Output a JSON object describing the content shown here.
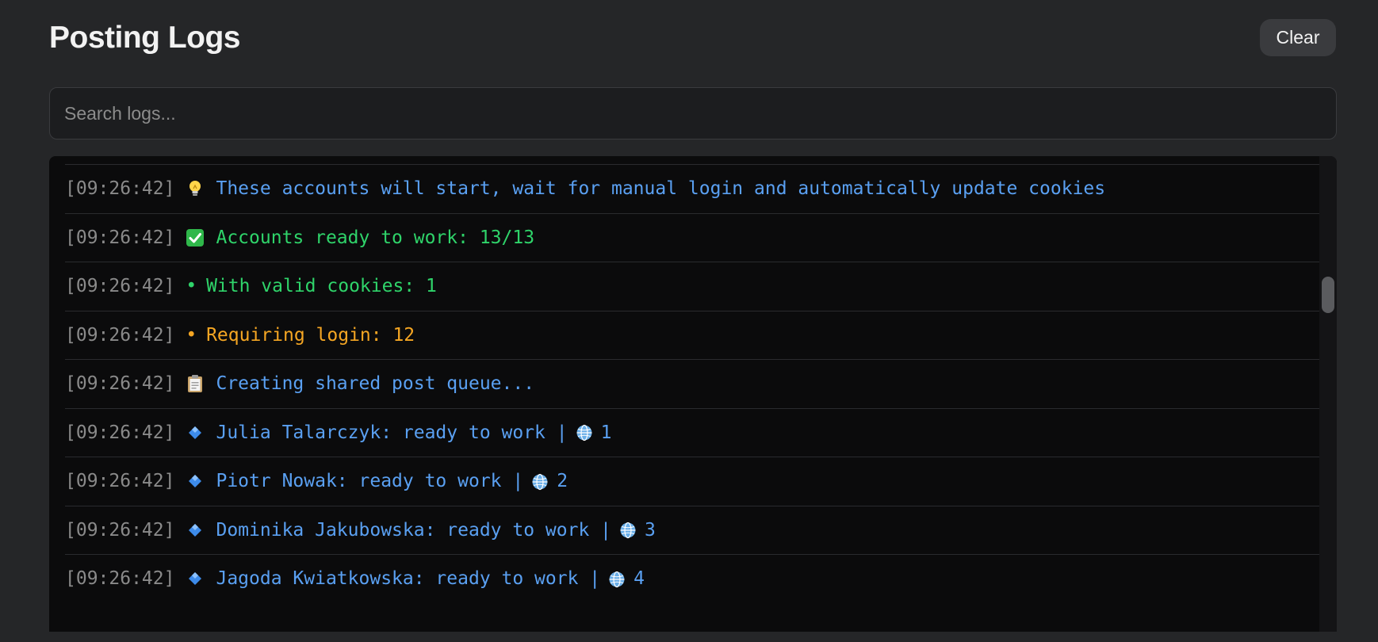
{
  "header": {
    "title": "Posting Logs",
    "clear_label": "Clear"
  },
  "search": {
    "placeholder": "Search logs...",
    "value": ""
  },
  "colors": {
    "info": "#5aa0f2",
    "success": "#2fd46a",
    "warning": "#f5a623",
    "timestamp": "#8a8a8a"
  },
  "logs": [
    {
      "time": "[09:26:42]",
      "icon": "lightbulb-icon",
      "message": "These accounts will start, wait for manual login and automatically update cookies",
      "level": "info"
    },
    {
      "time": "[09:26:42]",
      "icon": "check-mark-icon",
      "message": "Accounts ready to work: 13/13",
      "level": "success"
    },
    {
      "time": "[09:26:42]",
      "icon": "bullet-icon",
      "message": "With valid cookies: 1",
      "level": "success"
    },
    {
      "time": "[09:26:42]",
      "icon": "bullet-icon",
      "message": "Requiring login: 12",
      "level": "warning"
    },
    {
      "time": "[09:26:42]",
      "icon": "clipboard-icon",
      "message": "Creating shared post queue...",
      "level": "info"
    },
    {
      "time": "[09:26:42]",
      "icon": "blue-diamond-icon",
      "message": "Julia Talarczyk: ready to work |",
      "globe": "1",
      "level": "info"
    },
    {
      "time": "[09:26:42]",
      "icon": "blue-diamond-icon",
      "message": "Piotr Nowak: ready to work |",
      "globe": "2",
      "level": "info"
    },
    {
      "time": "[09:26:42]",
      "icon": "blue-diamond-icon",
      "message": "Dominika Jakubowska: ready to work |",
      "globe": "3",
      "level": "info"
    },
    {
      "time": "[09:26:42]",
      "icon": "blue-diamond-icon",
      "message": "Jagoda Kwiatkowska: ready to work |",
      "globe": "4",
      "level": "info"
    }
  ]
}
